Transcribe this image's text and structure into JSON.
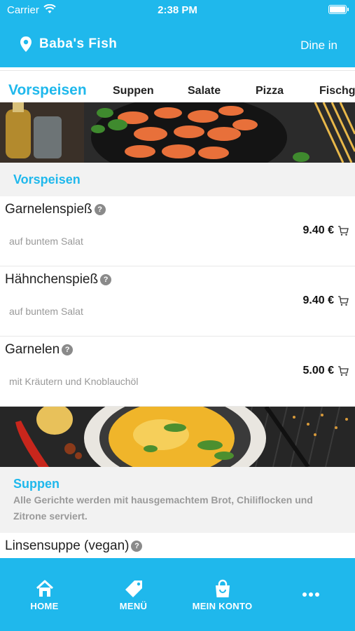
{
  "status": {
    "carrier": "Carrier",
    "time": "2:38 PM"
  },
  "header": {
    "restaurant": "Baba's Fish",
    "mode": "Dine in"
  },
  "tabs": [
    "Vorspeisen",
    "Suppen",
    "Salate",
    "Pizza",
    "Fischg"
  ],
  "sections": [
    {
      "title": "Vorspeisen",
      "items": [
        {
          "name": "Garnelenspieß",
          "desc": "auf buntem Salat",
          "price": "9.40 €"
        },
        {
          "name": "Hähnchenspieß",
          "desc": "auf buntem Salat",
          "price": "9.40 €"
        },
        {
          "name": "Garnelen",
          "desc": "mit Kräutern und Knoblauchöl",
          "price": "5.00 €"
        }
      ]
    },
    {
      "title": "Suppen",
      "desc": "Alle Gerichte werden mit hausgemachtem Brot, Chiliflocken und Zitrone serviert.",
      "items": [
        {
          "name": "Linsensuppe (vegan)"
        }
      ]
    }
  ],
  "help_glyph": "?",
  "bottom_nav": [
    {
      "label": "HOME",
      "icon": "home-icon"
    },
    {
      "label": "MENÜ",
      "icon": "tag-icon"
    },
    {
      "label": "MEIN KONTO",
      "icon": "shopping-bag-icon"
    },
    {
      "label": "",
      "icon": "more-icon"
    }
  ],
  "colors": {
    "accent": "#1fb8ec",
    "section_bg": "#f2f2f2",
    "muted": "#9a9a9a"
  }
}
